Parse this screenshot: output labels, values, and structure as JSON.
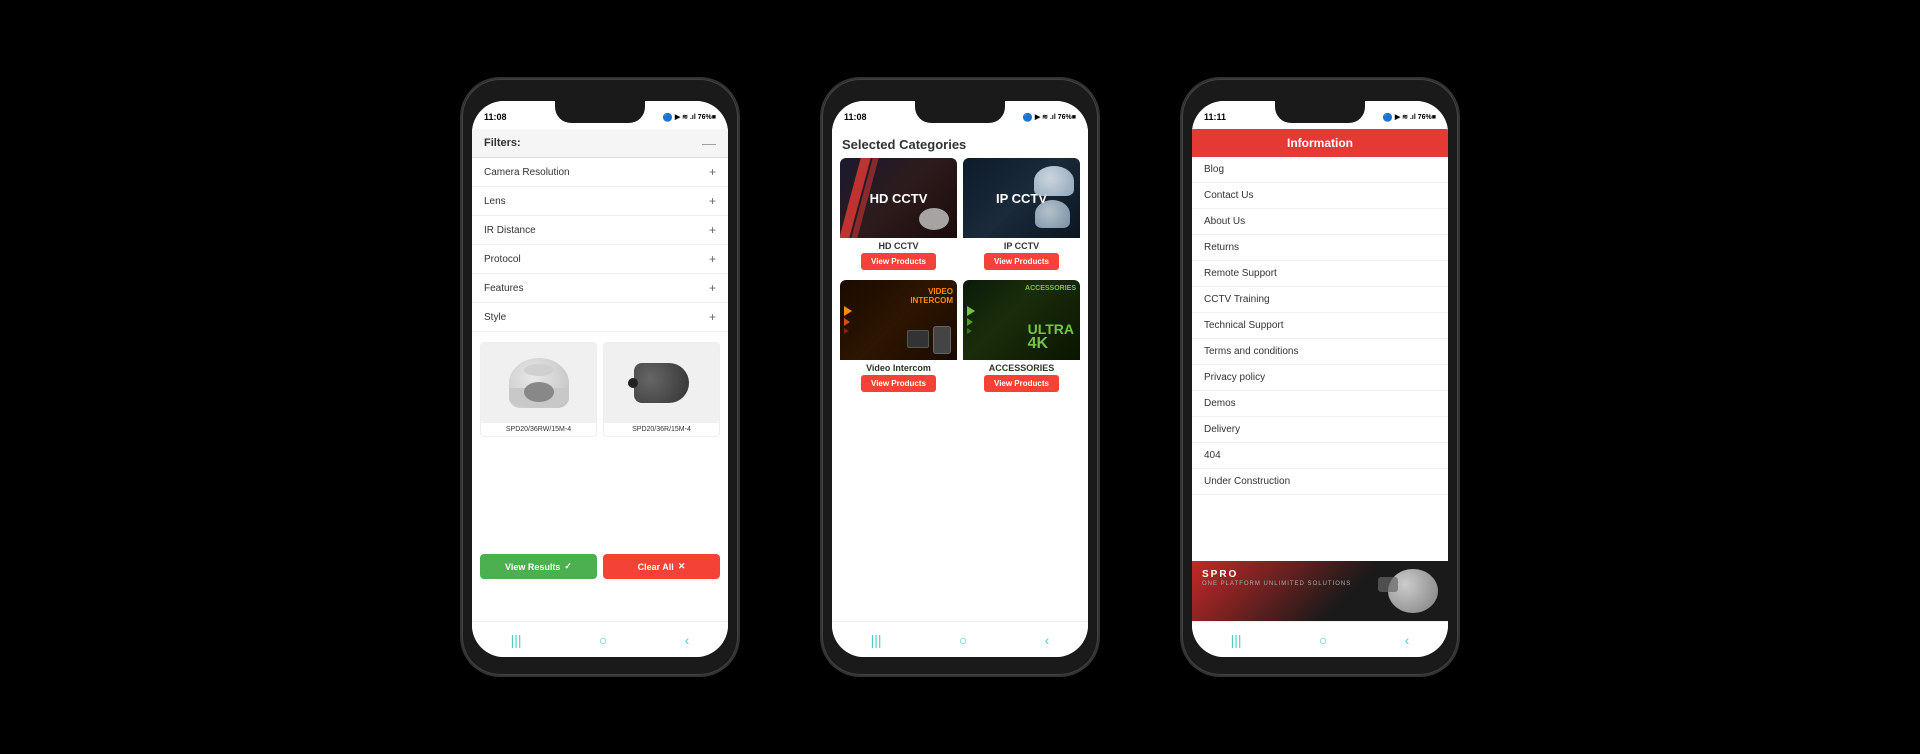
{
  "phones": [
    {
      "id": "phone-filters",
      "status_time": "11:08",
      "screen": "filters",
      "filters_label": "Filters:",
      "filter_rows": [
        "Camera Resolution",
        "Lens",
        "IR Distance",
        "Protocol",
        "Features",
        "Style"
      ],
      "product1_name": "SPD20/36RW/15M-4",
      "product2_name": "SPD20/36R/15M-4",
      "btn_view_results": "View Results",
      "btn_clear_all": "Clear All"
    },
    {
      "id": "phone-categories",
      "status_time": "11:08",
      "screen": "categories",
      "page_title": "Selected Categories",
      "categories": [
        {
          "id": "hd-cctv",
          "title": "HD CCTV",
          "btn": "View Products"
        },
        {
          "id": "ip-cctv",
          "title": "IP CCTV",
          "btn": "View Products"
        },
        {
          "id": "video-intercom",
          "title": "VIDEO\nINTERCOM",
          "btn": "View Products"
        },
        {
          "id": "accessories",
          "title": "ACCESSORIES",
          "btn": "View Products"
        }
      ]
    },
    {
      "id": "phone-information",
      "status_time": "11:11",
      "screen": "information",
      "section_title": "Information",
      "info_items": [
        "Blog",
        "Contact Us",
        "About Us",
        "Returns",
        "Remote Support",
        "CCTV Training",
        "Technical Support",
        "Terms and conditions",
        "Privacy policy",
        "Demos",
        "Delivery",
        "404",
        "Under Construction"
      ],
      "brand": "SPRO",
      "brand_sub": "ONE PLATFORM UNLIMITED SOLUTIONS"
    }
  ],
  "bottom_nav": {
    "icon1": "|||",
    "icon2": "○",
    "icon3": "‹"
  }
}
